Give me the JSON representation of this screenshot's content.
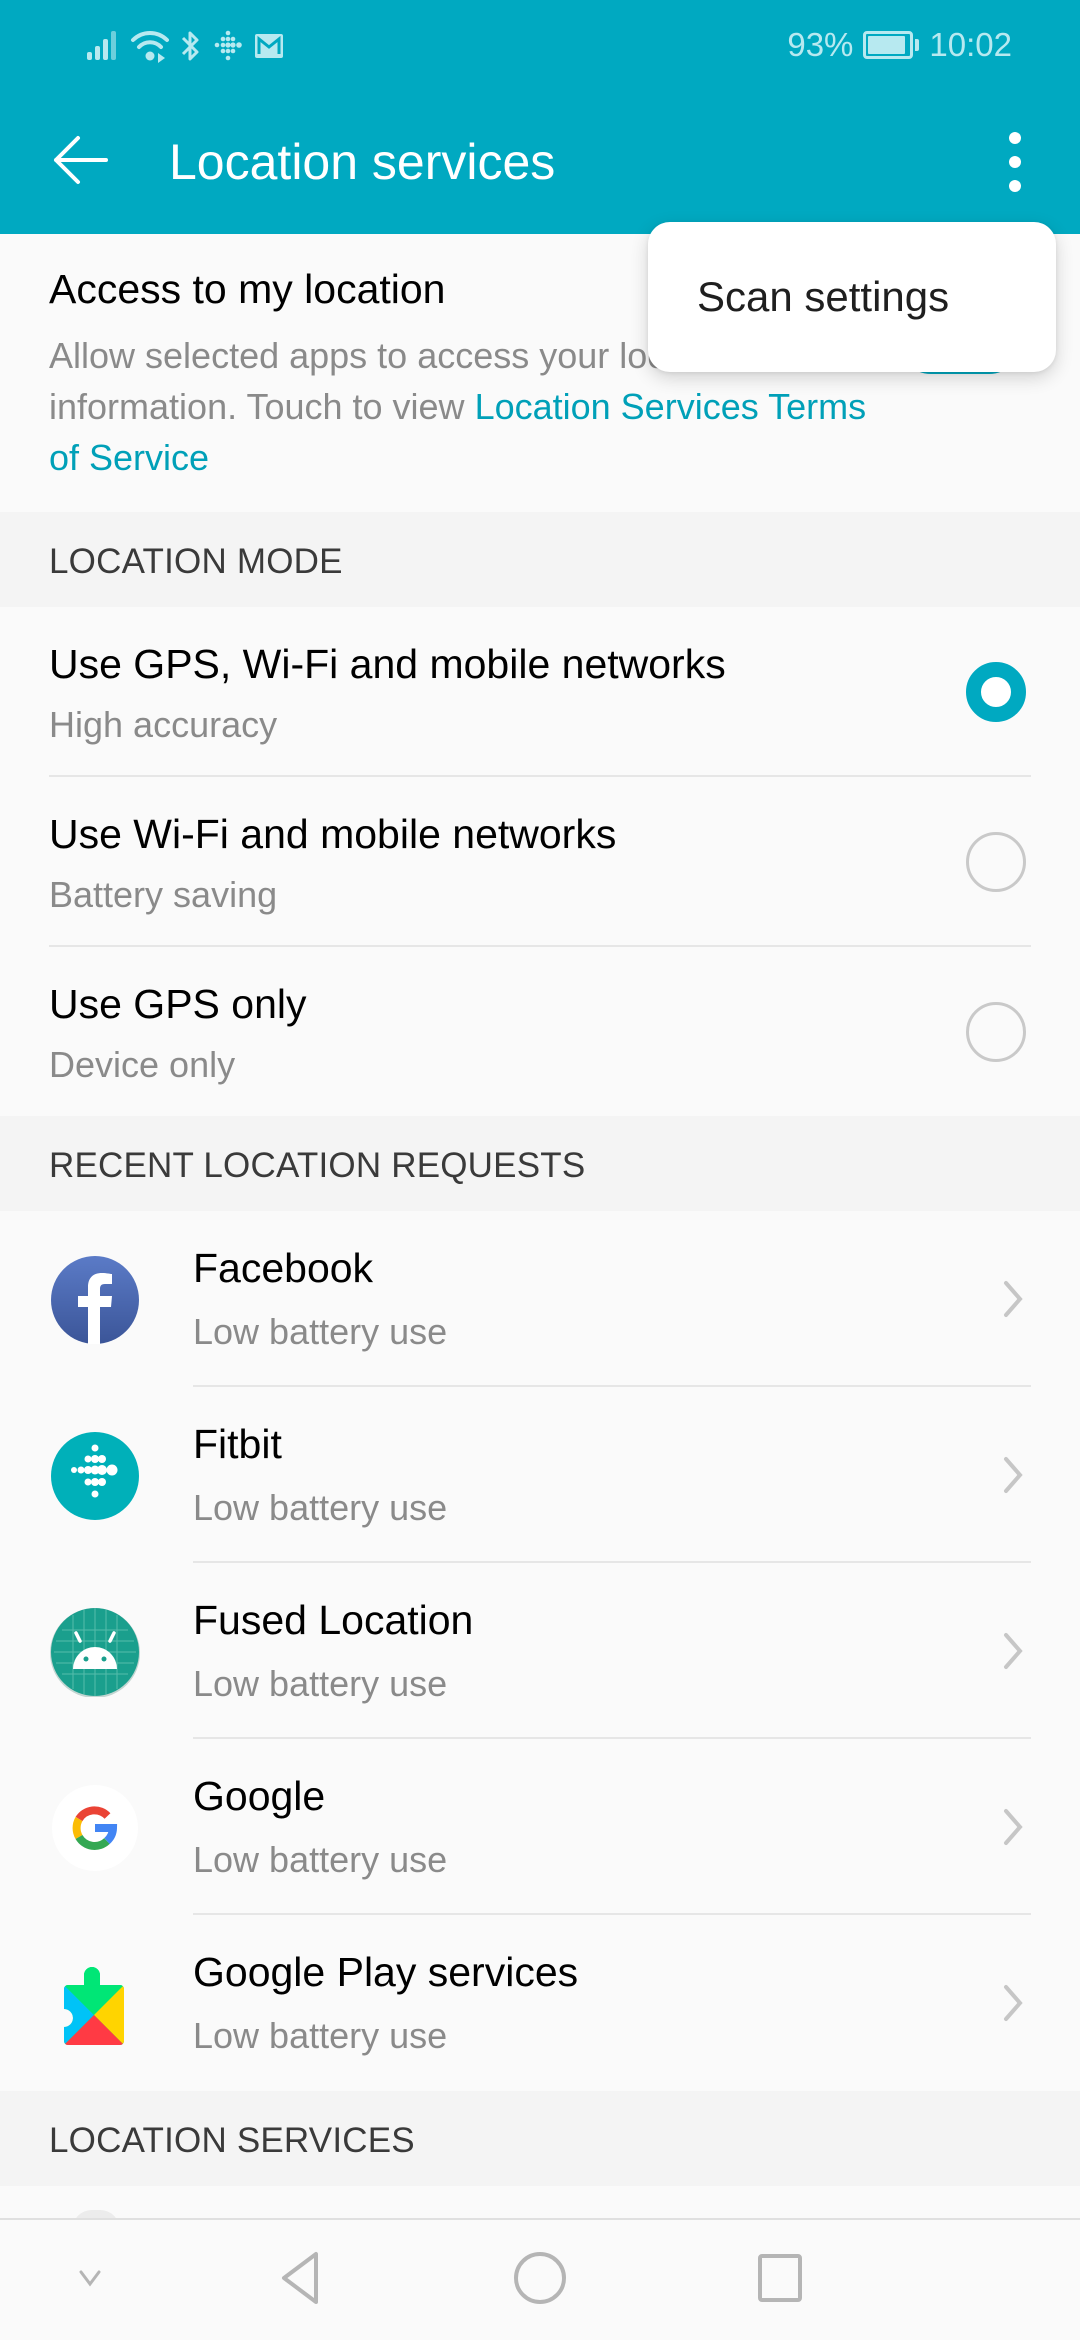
{
  "status_bar": {
    "icons": [
      "signal-icon",
      "wifi-icon",
      "bluetooth-icon",
      "fitbit-notification-icon",
      "gmail-notification-icon"
    ],
    "battery_percent_label": "93%",
    "battery_level": 0.93,
    "time": "10:02"
  },
  "toolbar": {
    "title": "Location services",
    "back_icon": "arrow-left-icon",
    "more_icon": "more-vertical-icon"
  },
  "overflow_menu": {
    "items": [
      {
        "label": "Scan settings"
      }
    ]
  },
  "access": {
    "title": "Access to my location",
    "description_prefix": "Allow selected apps to access your location information. Touch to view ",
    "link_text": "Location Services Terms of Service",
    "toggle_on": true
  },
  "location_mode": {
    "header": "LOCATION MODE",
    "options": [
      {
        "title": "Use GPS, Wi-Fi and mobile networks",
        "subtitle": "High accuracy",
        "selected": true
      },
      {
        "title": "Use Wi-Fi and mobile networks",
        "subtitle": "Battery saving",
        "selected": false
      },
      {
        "title": "Use GPS only",
        "subtitle": "Device only",
        "selected": false
      }
    ]
  },
  "recent_requests": {
    "header": "RECENT LOCATION REQUESTS",
    "apps": [
      {
        "name": "Facebook",
        "usage": "Low battery use",
        "icon": "facebook-icon"
      },
      {
        "name": "Fitbit",
        "usage": "Low battery use",
        "icon": "fitbit-icon"
      },
      {
        "name": "Fused Location",
        "usage": "Low battery use",
        "icon": "android-icon"
      },
      {
        "name": "Google",
        "usage": "Low battery use",
        "icon": "google-icon"
      },
      {
        "name": "Google Play services",
        "usage": "Low battery use",
        "icon": "google-play-services-icon"
      }
    ]
  },
  "location_services": {
    "header": "LOCATION SERVICES"
  },
  "nav_bar": {
    "buttons": [
      "hide-nav-icon",
      "back-triangle-icon",
      "home-circle-icon",
      "recents-square-icon"
    ]
  },
  "colors": {
    "accent": "#00a9c1",
    "link": "#00a0b8",
    "section_bg": "#f4f4f4",
    "subtitle": "#8a8a8a"
  }
}
